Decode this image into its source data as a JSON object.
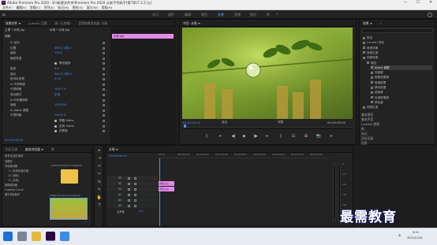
{
  "window": {
    "title": "Adobe Premiere Pro 2020 - D:\\新建文件夹\\Premiere Pro 2020 从新手到高手(第7章)7.2.2 [y]",
    "minimize": "─",
    "maximize": "☐",
    "close": "✕"
  },
  "menubar": [
    "文件(F)",
    "编辑(E)",
    "剪辑(C)",
    "序列(S)",
    "标记(M)",
    "图形(G)",
    "窗口(W)",
    "帮助(H)"
  ],
  "workspaces": {
    "items": [
      "学习",
      "组件",
      "编辑",
      "颜色",
      "效果",
      "音频",
      "图形",
      "库"
    ],
    "active_index": 4,
    "more": "»"
  },
  "effect_controls": {
    "tabs": [
      "效果控件 ≡",
      "Lumetri 范围",
      "源: (无剪辑)",
      "音频剪辑混合器: 水珠"
    ],
    "active_tab": 0,
    "header_left": "主要 * 水珠.jpg",
    "header_right": "水珠 * 水珠.jpg",
    "section_video": "视频",
    "rows": [
      {
        "label": "fx  运动",
        "value": "",
        "kind": "group"
      },
      {
        "label": "位置",
        "value": "360.0    288.0"
      },
      {
        "label": "缩放",
        "value": "100.0"
      },
      {
        "label": "缩放宽度",
        "value": ""
      },
      {
        "label": "",
        "value": "等比缩放",
        "kind": "check"
      },
      {
        "label": "旋转",
        "value": "0.0"
      },
      {
        "label": "锚点",
        "value": "360.0    288.0"
      },
      {
        "label": "防闪烁滤镜",
        "value": "0.00"
      },
      {
        "label": "fx  不透明度",
        "value": "",
        "kind": "group"
      },
      {
        "label": "不透明度",
        "value": "100.0 %"
      },
      {
        "label": "混合模式",
        "value": "正常"
      },
      {
        "label": "fx  时间重映射",
        "value": "",
        "kind": "group"
      },
      {
        "label": "速度",
        "value": "100.00%"
      },
      {
        "label": "fx  Alpha 调整",
        "value": "",
        "kind": "group"
      },
      {
        "label": "不透明度",
        "value": "100.0 %"
      },
      {
        "label": "",
        "value": "忽略 Alpha",
        "kind": "check"
      },
      {
        "label": "",
        "value": "反转 Alpha",
        "kind": "check"
      },
      {
        "label": "",
        "value": "仅蒙版",
        "kind": "check"
      }
    ],
    "clip_label": "水珠.jpg",
    "timecode": "00:00:00:00"
  },
  "program_monitor": {
    "tab": "节目: 水珠 ≡",
    "timecode": "00:00:00:12",
    "fit": "适合",
    "quality": "完整",
    "duration": "00:00:05:00",
    "controls": [
      "{",
      "⇤",
      "◀|",
      "▶",
      "|▶",
      "⇥",
      "}",
      "⊡",
      "⊞",
      "📷",
      "+"
    ]
  },
  "project": {
    "tabs": [
      "效果 ≡",
      "»"
    ],
    "tree": [
      {
        "label": "预设",
        "level": 0
      },
      {
        "label": "Lumetri 预设",
        "level": 0
      },
      {
        "label": "音频效果",
        "level": 0
      },
      {
        "label": "音频过渡",
        "level": 0
      },
      {
        "label": "视频效果",
        "level": 0
      },
      {
        "label": "键控",
        "level": 1
      },
      {
        "label": "Alpha 调整",
        "level": 2,
        "selected": true
      },
      {
        "label": "亮度键",
        "level": 2
      },
      {
        "label": "图像遮罩键",
        "level": 2
      },
      {
        "label": "差值遮罩",
        "level": 2
      },
      {
        "label": "移除遮罩",
        "level": 2
      },
      {
        "label": "超级键",
        "level": 2
      },
      {
        "label": "轨道遮罩键",
        "level": 2
      },
      {
        "label": "颜色键",
        "level": 2
      },
      {
        "label": "视频过渡",
        "level": 0
      }
    ],
    "bottom_list": [
      "基本图形",
      "基本声音",
      "Lumetri 颜色",
      "库",
      "标记",
      "历史记录",
      "信息"
    ]
  },
  "media": {
    "tabs": [
      "历史记录",
      "媒体浏览器 ≡",
      "库"
    ],
    "active_tab": 1,
    "filter": "所有支持的媒体",
    "tree": [
      "收藏夹",
      "本地驱动器",
      "C: (系统安装位置)",
      "D: (资料)",
      "E: (文档)",
      "网络驱动器",
      "Creative Cloud",
      "团队项目版本"
    ],
    "folder_label": "Adobe Premiere Pro Captured...",
    "thumb_label": "Adobe Premiere Pro Captured..."
  },
  "sequence": {
    "tab": "水珠 ≡",
    "timecode": "00:00:00:12",
    "ruler": [
      "00:00",
      "00:00:05:00",
      "00:00:10:00",
      "00:00:15:00",
      "00:00:20:00",
      "00:00:25:00",
      "00:00:30:00",
      "00:00:35:00",
      "00:00:40:00"
    ],
    "tracks_video": [
      "V3",
      "V2",
      "V1"
    ],
    "tracks_audio": [
      "A1",
      "A2",
      "A3"
    ],
    "master": "主声道",
    "master_value": "0.0",
    "clip_v2": "水珠.jpg",
    "clip_v1": "背景.jpg",
    "meter_labels": [
      "0",
      "-12",
      "-24",
      "-36",
      "-48",
      "dB"
    ]
  },
  "taskbar": {
    "time": "9:10",
    "date": "2021/11/24",
    "lang": "中"
  },
  "watermark": "最需教育",
  "colors": {
    "accent": "#4f8ff7",
    "clip_pink": "#e38be8",
    "panel_bg": "#232323"
  }
}
